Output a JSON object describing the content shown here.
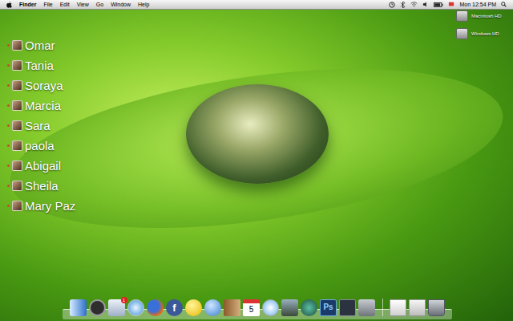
{
  "menu_bar": {
    "app": "Finder",
    "menus": [
      "File",
      "Edit",
      "View",
      "Go",
      "Window",
      "Help"
    ],
    "clock": "Mon 12:54 PM"
  },
  "desktop_icons": [
    {
      "label": "Macintosh HD"
    },
    {
      "label": "Windows HD"
    }
  ],
  "contacts": [
    {
      "name": "Omar"
    },
    {
      "name": "Tania"
    },
    {
      "name": "Soraya"
    },
    {
      "name": "Marcia"
    },
    {
      "name": "Sara"
    },
    {
      "name": "paola"
    },
    {
      "name": "Abigail"
    },
    {
      "name": "Sheila"
    },
    {
      "name": "Mary Paz"
    }
  ],
  "dock": {
    "apps": [
      {
        "kind": "finder"
      },
      {
        "kind": "dashboard"
      },
      {
        "kind": "mail",
        "badge": "1"
      },
      {
        "kind": "safari"
      },
      {
        "kind": "firefox"
      },
      {
        "kind": "facebook",
        "label": "f"
      },
      {
        "kind": "yahoo"
      },
      {
        "kind": "ichat"
      },
      {
        "kind": "addressbook"
      },
      {
        "kind": "ical",
        "label": "5"
      },
      {
        "kind": "itunes"
      },
      {
        "kind": "iphoto"
      },
      {
        "kind": "timemachine"
      },
      {
        "kind": "photoshop",
        "label": "Ps"
      },
      {
        "kind": "spaces"
      },
      {
        "kind": "sysprefs"
      }
    ],
    "stacks": [
      {
        "kind": "documents"
      },
      {
        "kind": "downloads"
      },
      {
        "kind": "trash"
      }
    ]
  }
}
